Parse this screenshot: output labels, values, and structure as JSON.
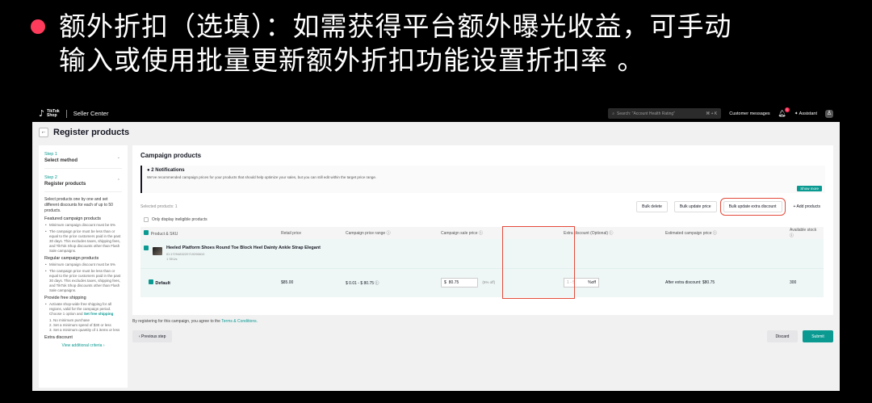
{
  "caption": {
    "line1": "额外折扣（选填）：如需获得平台额外曝光收益，可手动",
    "line2": "输入或使用批量更新额外折扣功能设置折扣率 。"
  },
  "topbar": {
    "brand_line1": "TikTok",
    "brand_line2": "Shop",
    "product": "Seller Center",
    "search_placeholder": "Search: \"Account Health Rating\"",
    "search_shortcut": "⌘ + K",
    "customer_messages": "Customer messages",
    "notif_count": "1",
    "assistant": "Assistant"
  },
  "page": {
    "back": "←",
    "title": "Register products"
  },
  "sidebar": {
    "step1_num": "Step 1",
    "step1_title": "Select method",
    "step2_num": "Step 2",
    "step2_title": "Register products",
    "intro": "Select products one by one and set different discounts for each of up to 50 products.",
    "featured_title": "Featured campaign products",
    "featured_1": "Minimum campaign discount must be 5%",
    "featured_2": "The campaign price must be less than or equal to the price customers paid in the past 30 days. This excludes taxes, shipping fees, and TikTok Shop discounts other than Flash Sale campaigns.",
    "regular_title": "Regular campaign products",
    "regular_1": "Minimum campaign discount must be 5%",
    "regular_2": "The campaign price must be less than or equal to the price customers paid in the past 30 days. This excludes taxes, shipping fees, and TikTok Shop discounts other than Flash Sale campaigns.",
    "free_title": "Provide free shipping",
    "free_1": "Activate shop-wide free shipping for all regions, valid for the campaign period. Choose 1 option and",
    "free_link": "Set free shipping",
    "opt1": "1. No minimum purchase",
    "opt2": "2. Set a minimum spend of $30 or less",
    "opt3": "3. Set a minimum quantity of 1 items or less",
    "extra_title": "Extra discount",
    "criteria": "View additional criteria  ›"
  },
  "card": {
    "title": "Campaign products",
    "notif_title": "2 Notifications",
    "notif_text": "We've recommended campaign prices for your products that should help optimize your sales, but you can still edit within the target price range.",
    "show_more": "Show more",
    "selected": "Selected products: 1",
    "bulk_delete": "Bulk delete",
    "bulk_update_price": "Bulk update price",
    "bulk_update_extra": "Bulk update extra discount",
    "add_products": "+ Add products",
    "only_eligible": "Only display ineligible products"
  },
  "table": {
    "headers": {
      "product": "Product & SKU",
      "retail": "Retail price",
      "range": "Campaign price range ⓘ",
      "sale": "Campaign sale price ⓘ",
      "extra": "Extra discount (Optional) ⓘ",
      "estimated": "Estimated campaign price ⓘ",
      "stock": "Available stock ⓘ"
    },
    "product": {
      "name": "Heeled Platform Shoes Round Toe Block Heel Dainty Ankle Strap Elegant",
      "id": "ID:1729483220719296610",
      "skus": "1 SKUs"
    },
    "variant": {
      "name": "Default",
      "retail": "$85.00",
      "range": "$ 0.01 - $ 80.75 ⓘ",
      "currency": "$",
      "sale": "80.75",
      "pct": "(5% off)",
      "extra_placeholder": "1 - 5",
      "extra_unit": "%off",
      "estimated": "After extra discount: $80.75",
      "stock": "300"
    }
  },
  "footer": {
    "agree_text": "By registering for this campaign, you agree to the",
    "agree_link": "Terms & Conditions.",
    "prev": "‹  Previous step",
    "discard": "Discard",
    "submit": "Submit"
  }
}
